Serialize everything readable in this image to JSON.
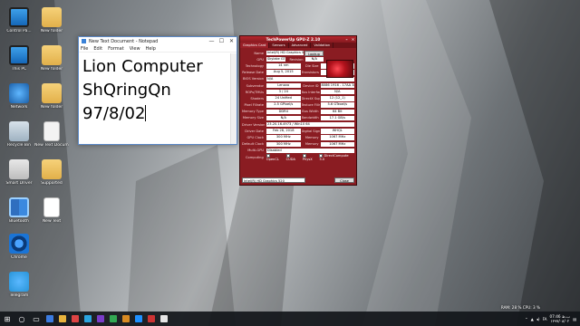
{
  "desktop": {
    "icons": [
      {
        "label": "Control Pa...",
        "kind": "g-monitor"
      },
      {
        "label": "This PC",
        "kind": "g-monitor"
      },
      {
        "label": "Network",
        "kind": "g-net"
      },
      {
        "label": "Recycle Bin",
        "kind": "g-bin"
      },
      {
        "label": "Smart Driver",
        "kind": "g-box"
      },
      {
        "label": "Bluetooth",
        "kind": "g-tiles"
      },
      {
        "label": "Chrome",
        "kind": "g-round"
      },
      {
        "label": "Telegram",
        "kind": "g-telegram"
      },
      {
        "label": "New folder",
        "kind": "g-folder"
      },
      {
        "label": "New folder",
        "kind": "g-folder"
      },
      {
        "label": "New folder",
        "kind": "g-folder"
      },
      {
        "label": "New Text Document",
        "kind": "g-doc"
      },
      {
        "label": "Supported",
        "kind": "g-folder"
      },
      {
        "label": "New Text",
        "kind": "g-sheet"
      }
    ]
  },
  "notepad": {
    "title": "New Text Document - Notepad",
    "menu": [
      "File",
      "Edit",
      "Format",
      "View",
      "Help"
    ],
    "lines": [
      "Lion Computer",
      "ShQringQn",
      "97/8/02"
    ],
    "window_buttons": [
      "—",
      "☐",
      "✕"
    ]
  },
  "gpuz": {
    "title": "TechPowerUp GPU-Z 2.10",
    "tabs": [
      "Graphics Card",
      "Sensors",
      "Advanced",
      "Validation"
    ],
    "lookup": "Lookup",
    "rows": [
      {
        "k": "Name",
        "v": "Intel(R) HD Graphics 520"
      },
      {
        "k": "GPU",
        "v": "Skylake GT2",
        "k2": "Revision",
        "v2": "N/A"
      },
      {
        "k": "Technology",
        "v": "14 nm",
        "k2": "Die Size",
        "v2": "Unknown"
      },
      {
        "k": "Release Date",
        "v": "Aug 5, 2015",
        "k2": "Transistors",
        "v2": "Unknown"
      },
      {
        "k": "BIOS Version",
        "v": "N/A"
      },
      {
        "k": "Subvendor",
        "v": "Lenovo",
        "k2": "Device ID",
        "v2": "8086 1916 - 17AA 3802"
      },
      {
        "k": "ROPs/TMUs",
        "v": "3 / 24",
        "k2": "Bus Interface",
        "v2": "N/A"
      },
      {
        "k": "Shaders",
        "v": "24 Unified",
        "k2": "DirectX Support",
        "v2": "12 (12_1)"
      },
      {
        "k": "Pixel Fillrate",
        "v": "2.5 GPixel/s",
        "k2": "Texture Fillrate",
        "v2": "5.6 GTexel/s"
      },
      {
        "k": "Memory Type",
        "v": "DDR4",
        "k2": "Bus Width",
        "v2": "64 Bit"
      },
      {
        "k": "Memory Size",
        "v": "N/A",
        "k2": "Bandwidth",
        "v2": "17.1 GB/s"
      },
      {
        "k": "Driver Version",
        "v": "23.20.16.4973 / Win10 64"
      },
      {
        "k": "Driver Date",
        "v": "Feb 28, 2018",
        "k2": "Digital Signature",
        "v2": "WHQL"
      },
      {
        "k": "GPU Clock",
        "v": "300 MHz",
        "k2": "Memory",
        "v2": "1067 MHz"
      },
      {
        "k": "Default Clock",
        "v": "300 MHz",
        "k2": "Memory",
        "v2": "1067 MHz"
      },
      {
        "k": "Multi-GPU",
        "v": "Disabled"
      }
    ],
    "computing_label": "Computing",
    "computing": [
      "OpenCL",
      "CUDA",
      "PhysX",
      "DirectCompute 5.0"
    ],
    "selected_gpu": "Intel(R) HD Graphics 520",
    "close": "Close"
  },
  "overlay": {
    "ram": "RAM: 28 %  CPU: 3 %"
  },
  "taskbar": {
    "start_icon": "windows-logo-icon",
    "apps": [
      "#3b7be0",
      "#e8b33c",
      "#d44",
      "#2aa5e0",
      "#7a3cc9",
      "#33a853",
      "#d88a22",
      "#1e90ff",
      "#c33",
      "#e6e6e6"
    ],
    "time": "07:46 ب.ظ",
    "date": "۱۳۹۷/۰۸/۰۲",
    "lang": "FA"
  },
  "colors": {
    "gpuz_red": "#8a1c22",
    "notepad_border": "#5b89c8"
  }
}
